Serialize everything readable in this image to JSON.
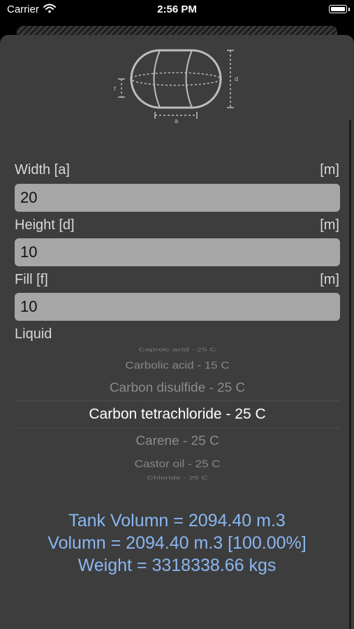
{
  "status_bar": {
    "carrier": "Carrier",
    "time": "2:56 PM"
  },
  "diagram": {
    "label_a": "a",
    "label_d": "d",
    "label_f": "f"
  },
  "fields": [
    {
      "label": "Width [a]",
      "unit": "[m]",
      "value": "20"
    },
    {
      "label": "Height [d]",
      "unit": "[m]",
      "value": "10"
    },
    {
      "label": "Fill [f]",
      "unit": "[m]",
      "value": "10"
    }
  ],
  "liquid": {
    "label": "Liquid",
    "options": [
      "Caproic acid - 25 C",
      "Carbolic acid - 15 C",
      "Carbon disulfide - 25 C",
      "Carbon tetrachloride - 25 C",
      "Carene - 25 C",
      "Castor oil - 25 C",
      "Chloride - 25 C"
    ],
    "selected": "Carbon tetrachloride - 25 C"
  },
  "results": {
    "tank_volume": "Tank Volumn = 2094.40 m.3",
    "volume": "Volumn = 2094.40 m.3 [100.00%]",
    "weight": "Weight = 3318338.66 kgs"
  },
  "colors": {
    "background": "#3d3d3d",
    "field": "#a6a6a6",
    "result_text": "#8ab7f2"
  }
}
